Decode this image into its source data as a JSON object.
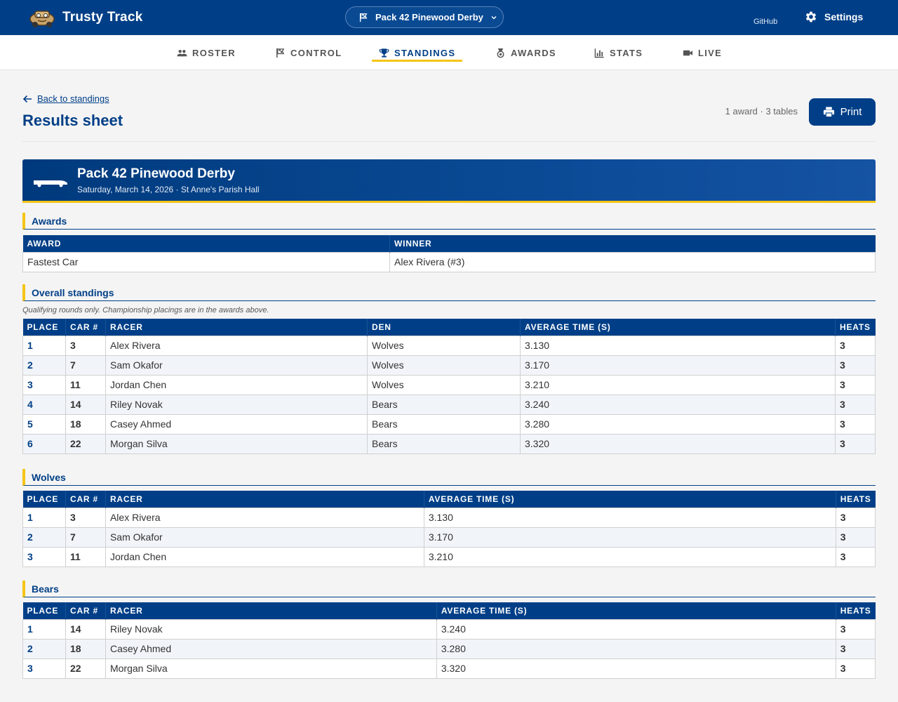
{
  "app": {
    "name": "Trusty Track"
  },
  "event_selector": {
    "label": "Pack 42 Pinewood Derby"
  },
  "header": {
    "github_label": "GitHub",
    "settings_label": "Settings"
  },
  "tabs": [
    {
      "label": "ROSTER",
      "icon": "group-icon"
    },
    {
      "label": "CONTROL",
      "icon": "flag-icon"
    },
    {
      "label": "STANDINGS",
      "icon": "trophy-icon",
      "active": true
    },
    {
      "label": "AWARDS",
      "icon": "medal-icon"
    },
    {
      "label": "STATS",
      "icon": "bar-chart-icon"
    },
    {
      "label": "LIVE",
      "icon": "video-icon"
    }
  ],
  "page": {
    "back_label": "Back to standings",
    "title": "Results sheet",
    "counts": "1 award · 3 tables",
    "print_label": "Print"
  },
  "event": {
    "title": "Pack 42 Pinewood Derby",
    "subtitle": "Saturday, March 14, 2026 · St Anne's Parish Hall"
  },
  "awards": {
    "title": "Awards",
    "headers": [
      "AWARD",
      "WINNER"
    ],
    "rows": [
      [
        "Fastest Car",
        "Alex Rivera (#3)"
      ]
    ]
  },
  "overall": {
    "title": "Overall standings",
    "note": "Qualifying rounds only. Championship placings are in the awards above.",
    "headers": [
      "PLACE",
      "CAR #",
      "RACER",
      "DEN",
      "AVERAGE TIME (S)",
      "HEATS"
    ],
    "rows": [
      [
        "1",
        "3",
        "Alex Rivera",
        "Wolves",
        "3.130",
        "3"
      ],
      [
        "2",
        "7",
        "Sam Okafor",
        "Wolves",
        "3.170",
        "3"
      ],
      [
        "3",
        "11",
        "Jordan Chen",
        "Wolves",
        "3.210",
        "3"
      ],
      [
        "4",
        "14",
        "Riley Novak",
        "Bears",
        "3.240",
        "3"
      ],
      [
        "5",
        "18",
        "Casey Ahmed",
        "Bears",
        "3.280",
        "3"
      ],
      [
        "6",
        "22",
        "Morgan Silva",
        "Bears",
        "3.320",
        "3"
      ]
    ]
  },
  "wolves": {
    "title": "Wolves",
    "headers": [
      "PLACE",
      "CAR #",
      "RACER",
      "AVERAGE TIME (S)",
      "HEATS"
    ],
    "rows": [
      [
        "1",
        "3",
        "Alex Rivera",
        "3.130",
        "3"
      ],
      [
        "2",
        "7",
        "Sam Okafor",
        "3.170",
        "3"
      ],
      [
        "3",
        "11",
        "Jordan Chen",
        "3.210",
        "3"
      ]
    ]
  },
  "bears": {
    "title": "Bears",
    "headers": [
      "PLACE",
      "CAR #",
      "RACER",
      "AVERAGE TIME (S)",
      "HEATS"
    ],
    "rows": [
      [
        "1",
        "14",
        "Riley Novak",
        "3.240",
        "3"
      ],
      [
        "2",
        "18",
        "Casey Ahmed",
        "3.280",
        "3"
      ],
      [
        "3",
        "22",
        "Morgan Silva",
        "3.320",
        "3"
      ]
    ]
  },
  "colors": {
    "primary": "#003f87",
    "accent": "#f5c518"
  }
}
